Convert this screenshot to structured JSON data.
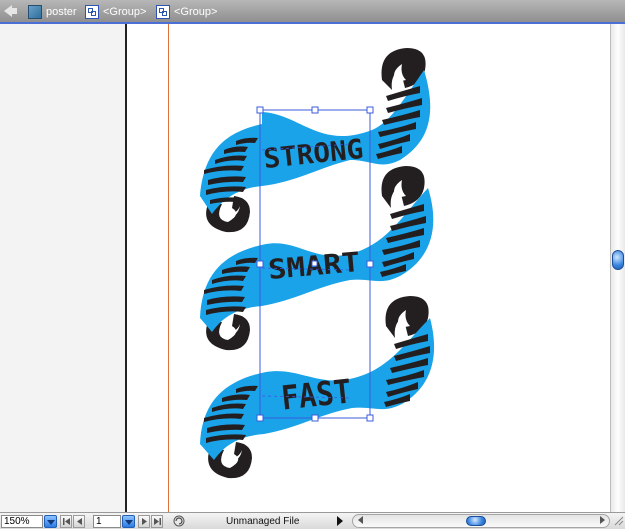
{
  "breadcrumb": {
    "items": [
      {
        "label": "poster",
        "icon": "layer-icon"
      },
      {
        "label": "<Group>",
        "icon": "group-icon"
      },
      {
        "label": "<Group>",
        "icon": "group-icon"
      }
    ]
  },
  "artwork": {
    "banners": [
      "STRONG",
      "SMART",
      "FAST"
    ],
    "banner_color": "#1aa3e8",
    "ink_color": "#231f20",
    "selection_color": "#3b5bdb",
    "margin_guide_color": "#e0703a"
  },
  "status_bar": {
    "zoom": "150%",
    "page": "1",
    "status_text": "Unmanaged File"
  },
  "scroll": {
    "horizontal_position": 0.5,
    "vertical_position": 0.49
  }
}
